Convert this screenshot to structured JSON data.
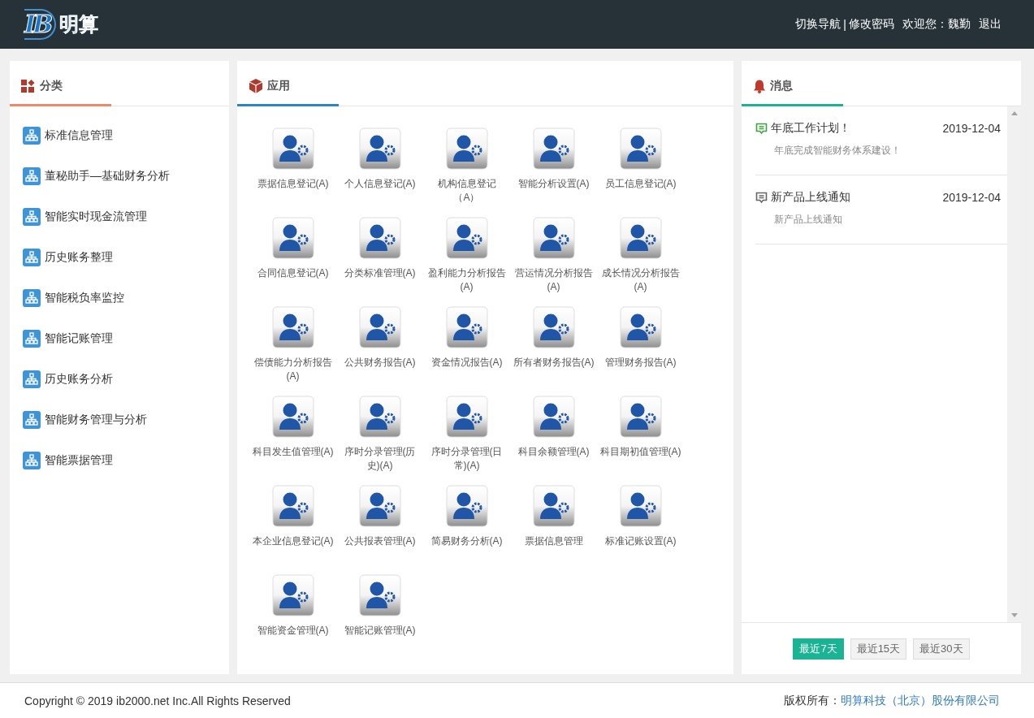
{
  "header": {
    "logo_mark": "IB",
    "logo_text": "明算",
    "links": [
      {
        "kind": "link",
        "label": "切换导航"
      },
      {
        "kind": "separator",
        "label": "|"
      },
      {
        "kind": "link",
        "label": "修改密码"
      },
      {
        "kind": "text",
        "label": "欢迎您：魏勤"
      },
      {
        "kind": "link",
        "label": "退出"
      }
    ]
  },
  "categories": {
    "title": "分类",
    "items": [
      "标准信息管理",
      "董秘助手—基础财务分析",
      "智能实时现金流管理",
      "历史账务整理",
      "智能税负率监控",
      "智能记账管理",
      "历史账务分析",
      "智能财务管理与分析",
      "智能票据管理"
    ]
  },
  "apps": {
    "title": "应用",
    "items": [
      "票据信息登记(A)",
      "个人信息登记(A)",
      "机构信息登记（A）",
      "智能分析设置(A)",
      "员工信息登记(A)",
      "合同信息登记(A)",
      "分类标准管理(A)",
      "盈利能力分析报告(A)",
      "营运情况分析报告(A)",
      "成长情况分析报告(A)",
      "偿债能力分析报告(A)",
      "公共财务报告(A)",
      "资金情况报告(A)",
      "所有者财务报告(A)",
      "管理财务报告(A)",
      "科目发生值管理(A)",
      "序时分录管理(历史)(A)",
      "序时分录管理(日常)(A)",
      "科目余额管理(A)",
      "科目期初值管理(A)",
      "本企业信息登记(A)",
      "公共报表管理(A)",
      "简易财务分析(A)",
      "票据信息管理",
      "标准记账设置(A)",
      "智能资金管理(A)",
      "智能记账管理(A)"
    ]
  },
  "messages": {
    "title": "消息",
    "items": [
      {
        "title": "年底工作计划！",
        "date": "2019-12-04",
        "body": "年底完成智能财务体系建设！",
        "color": "#3ca33f"
      },
      {
        "title": "新产品上线通知",
        "date": "2019-12-04",
        "body": "新产品上线通知",
        "color": "#666666"
      }
    ],
    "filters": [
      {
        "label": "最近7天",
        "selected": true
      },
      {
        "label": "最近15天",
        "selected": false
      },
      {
        "label": "最近30天",
        "selected": false
      }
    ]
  },
  "footer": {
    "copyright": "Copyright © 2019 ib2000.net Inc.All Rights Reserved",
    "rights_label": "版权所有：",
    "company": "明算科技（北京）股份有限公司"
  }
}
